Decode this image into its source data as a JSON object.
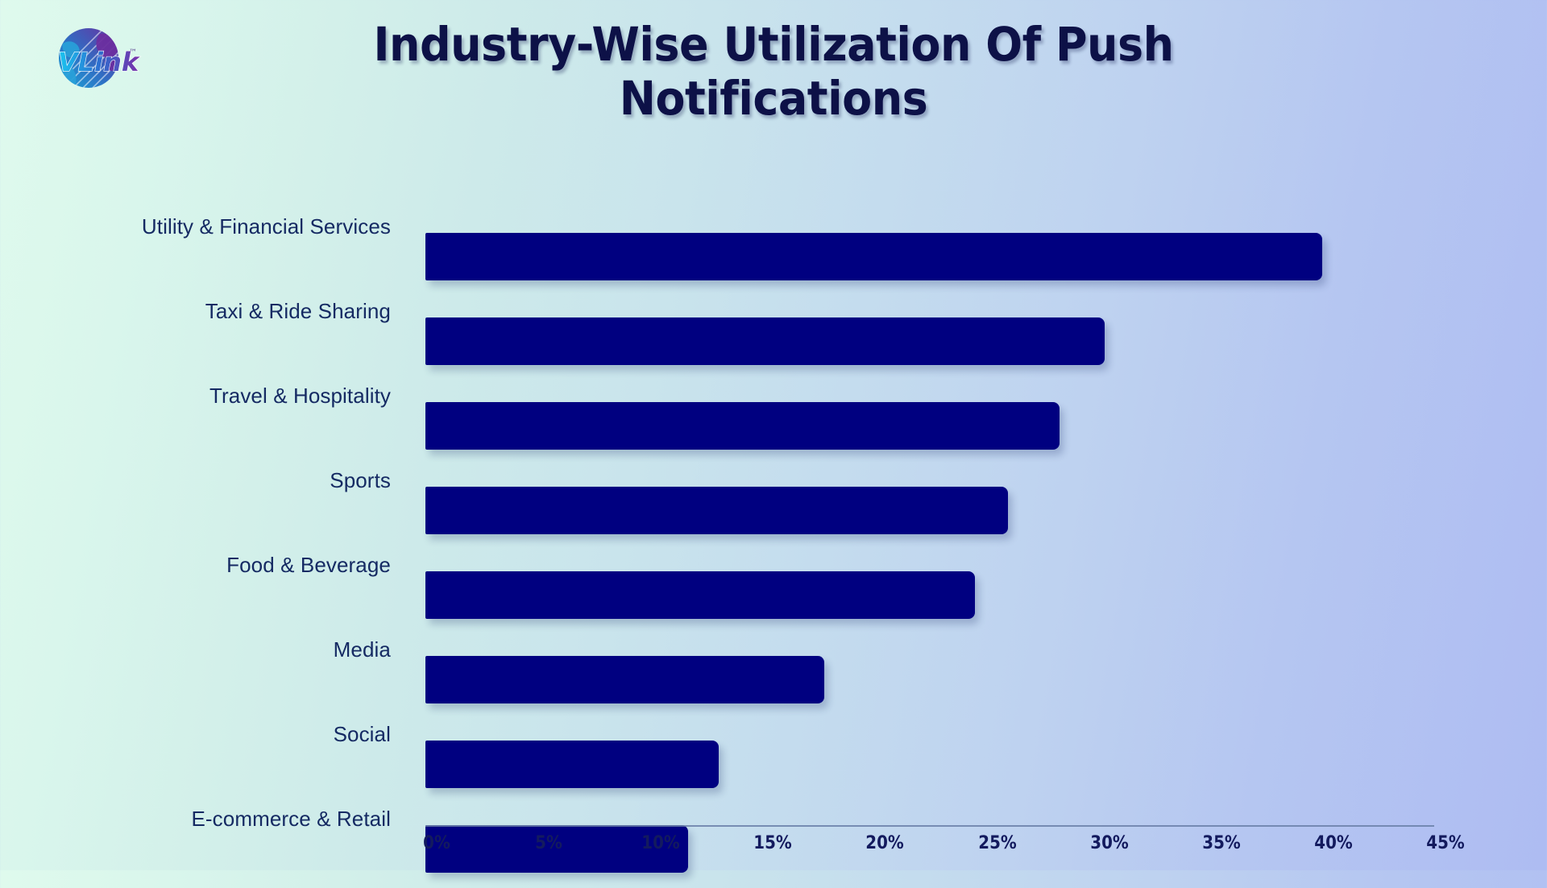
{
  "brand": {
    "logo_name": "vlink-logo",
    "logo_text": "VLink",
    "trademark": "™"
  },
  "chart_data": {
    "type": "bar",
    "orientation": "horizontal",
    "title": "Industry-Wise Utilization Of Push Notifications",
    "xlabel": "",
    "ylabel": "",
    "xlim": [
      0,
      45
    ],
    "grid": false,
    "legend": "none",
    "bar_color": "#000080",
    "label_color": "#152a63",
    "title_color": "#0d1147",
    "background_start": "#dffaed",
    "background_end": "#aebcf2",
    "categories": [
      "Utility & Financial Services",
      "Taxi & Ride Sharing",
      "Travel & Hospitality",
      "Sports",
      "Food & Beverage",
      "Media",
      "Social",
      "E-commerce & Retail"
    ],
    "values": [
      40,
      30.3,
      28.3,
      26,
      24.5,
      17.8,
      13.1,
      11.7
    ],
    "value_unit": "%",
    "tick_labels": [
      "0%",
      "5%",
      "10%",
      "15%",
      "20%",
      "25%",
      "30%",
      "35%",
      "40%",
      "45%"
    ],
    "tick_values": [
      0,
      5,
      10,
      15,
      20,
      25,
      30,
      35,
      40,
      45
    ]
  }
}
